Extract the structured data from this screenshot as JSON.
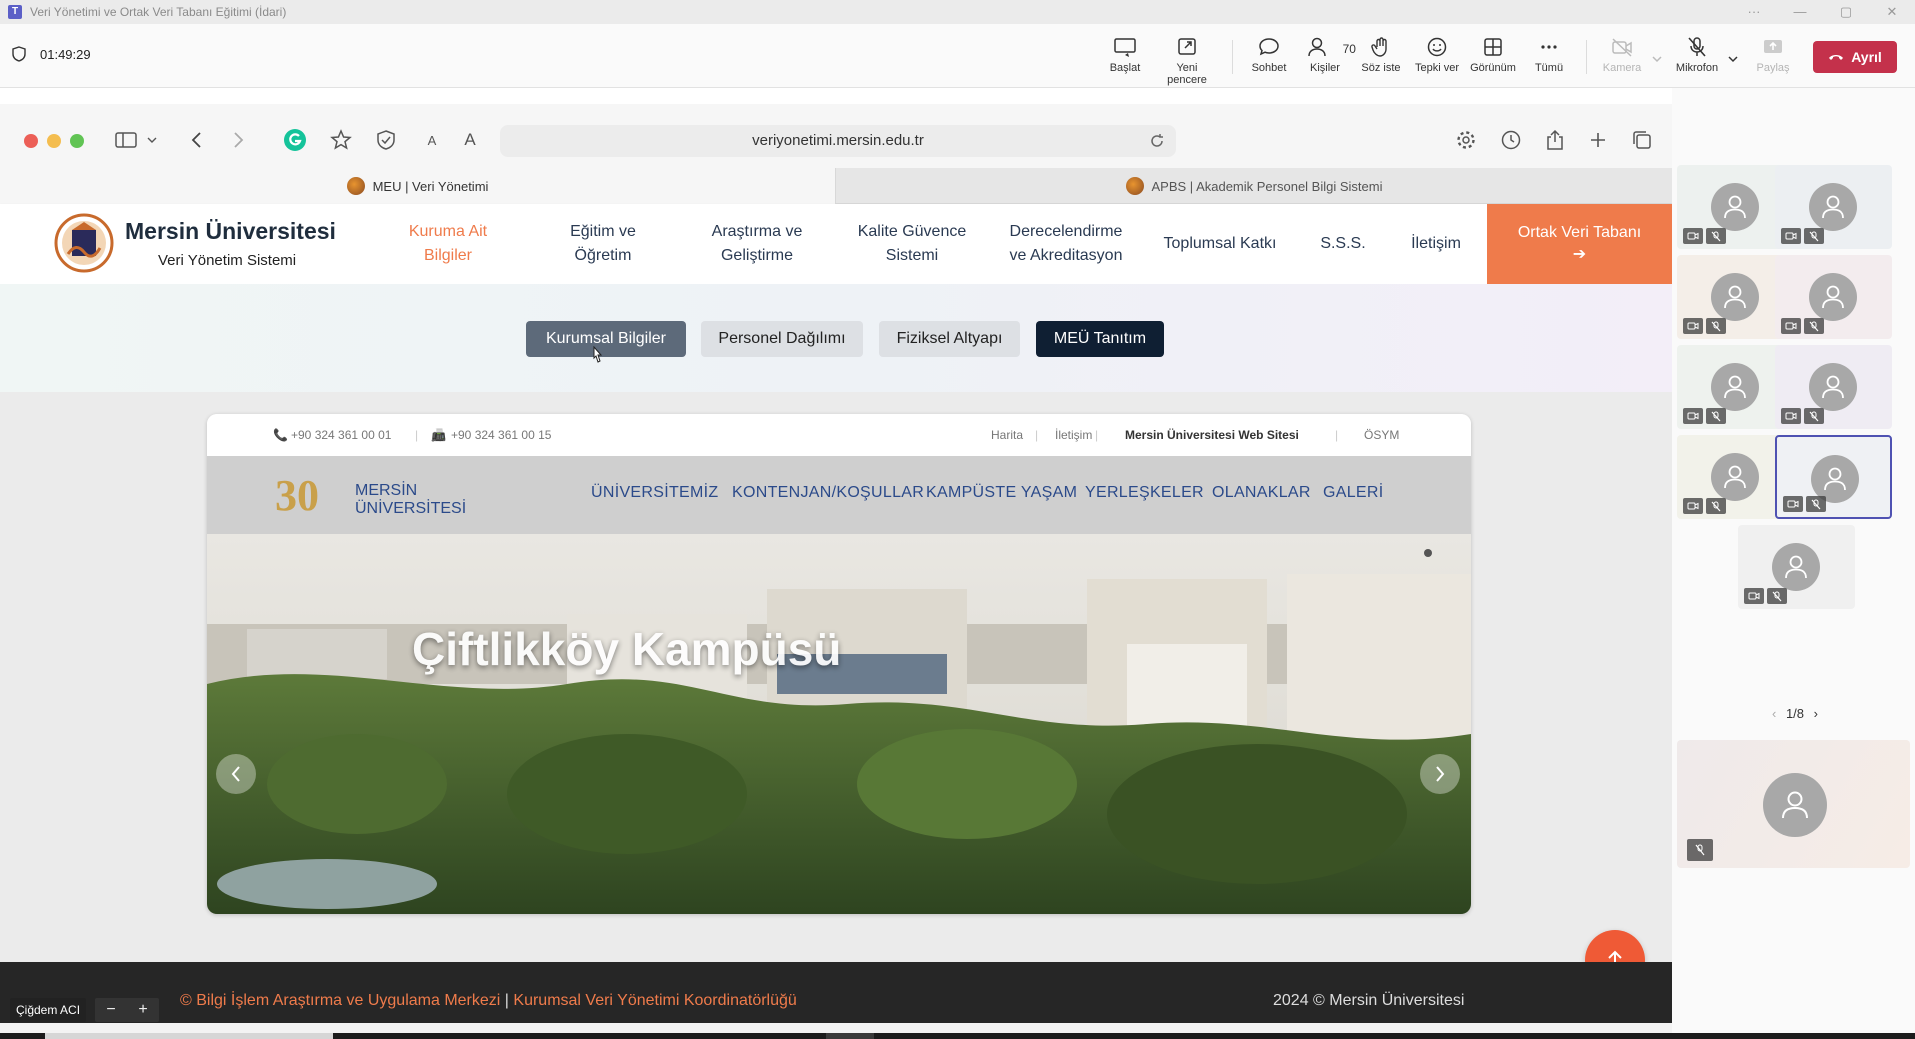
{
  "window": {
    "title": "Veri Yönetimi ve Ortak Veri Tabanı Eğitimi (İdari)"
  },
  "toolbar": {
    "timer": "01:49:29",
    "start": "Başlat",
    "new_window": "Yeni pencere",
    "chat": "Sohbet",
    "people": "Kişiler",
    "people_count": "70",
    "raise_hand": "Söz iste",
    "react": "Tepki ver",
    "view": "Görünüm",
    "more": "Tümü",
    "camera": "Kamera",
    "mic": "Mikrofon",
    "share": "Paylaş",
    "leave": "Ayrıl"
  },
  "browser": {
    "url": "veriyonetimi.mersin.edu.tr",
    "tabs": [
      {
        "label": "MEU | Veri Yönetimi"
      },
      {
        "label": "APBS | Akademik Personel Bilgi Sistemi"
      }
    ],
    "font_small": "A",
    "font_large": "A"
  },
  "site": {
    "name": "Mersin Üniversitesi",
    "subtitle": "Veri Yönetim Sistemi",
    "menu": [
      {
        "line1": "Kuruma Ait",
        "line2": "Bilgiler"
      },
      {
        "line1": "Eğitim ve",
        "line2": "Öğretim"
      },
      {
        "line1": "Araştırma ve",
        "line2": "Geliştirme"
      },
      {
        "line1": "Kalite Güvence",
        "line2": "Sistemi"
      },
      {
        "line1": "Derecelendirme",
        "line2": "ve Akreditasyon"
      },
      {
        "line1": "Toplumsal Katkı",
        "line2": ""
      },
      {
        "line1": "S.S.S.",
        "line2": ""
      },
      {
        "line1": "İletişim",
        "line2": ""
      }
    ],
    "cta": "Ortak Veri Tabanı",
    "cta_arrow": "➔",
    "sub_buttons": [
      "Kurumsal Bilgiler",
      "Personel Dağılımı",
      "Fiziksel Altyapı",
      "MEÜ Tanıtım"
    ]
  },
  "embed": {
    "phone1": "+90 324 361 00 01",
    "phone2": "+90 324 361 00 15",
    "links": [
      "Harita",
      "İletişim",
      "Mersin Üniversitesi Web Sitesi",
      "ÖSYM"
    ],
    "logo_text": "MERSİN ÜNİVERSİTESİ",
    "logo_number": "30",
    "nav": [
      "ÜNİVERSİTEMİZ",
      "KONTENJAN/KOŞULLAR",
      "KAMPÜSTE YAŞAM",
      "YERLEŞKELER",
      "OLANAKLAR",
      "GALERİ"
    ],
    "hero_title": "Çiftlikköy Kampüsü"
  },
  "footer": {
    "left": "© Bilgi İşlem Araştırma ve Uygulama Merkezi",
    "separator": "|",
    "left2": "Kurumsal Veri Yönetimi Koordinatörlüğü",
    "right": "2024 © Mersin Üniversitesi"
  },
  "presenter": {
    "name": "Çiğdem ACI",
    "zoom_minus": "−",
    "zoom_plus": "+"
  },
  "panel": {
    "pager": "1/8",
    "tile_count": 9
  },
  "colors": {
    "accent": "#ef7b4b",
    "leave": "#c4314b",
    "teams": "#5b5fc7"
  }
}
